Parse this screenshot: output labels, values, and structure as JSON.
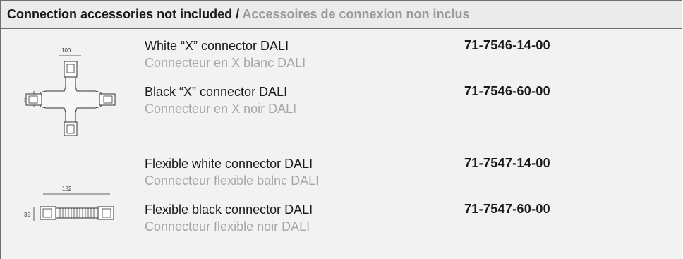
{
  "header": {
    "title_en": "Connection accessories not included",
    "separator": " / ",
    "title_fr": "Accessoires de connexion non inclus"
  },
  "sections": [
    {
      "drawing": {
        "icon": "x-connector-drawing",
        "width_dim": "100",
        "height_dim": "35"
      },
      "items": [
        {
          "name": "White “X” connector DALI",
          "name_fr": "Connecteur en X blanc DALI",
          "code": "71-7546-14-00"
        },
        {
          "name": "Black “X” connector DALI",
          "name_fr": "Connecteur en X noir DALI",
          "code": "71-7546-60-00"
        }
      ]
    },
    {
      "drawing": {
        "icon": "flexible-connector-drawing",
        "width_dim": "182",
        "height_dim": "35"
      },
      "items": [
        {
          "name": "Flexible white connector DALI",
          "name_fr": "Connecteur flexible balnc DALI",
          "code": "71-7547-14-00"
        },
        {
          "name": "Flexible black connector DALI",
          "name_fr": "Connecteur flexible noir DALI",
          "code": "71-7547-60-00"
        }
      ]
    }
  ]
}
